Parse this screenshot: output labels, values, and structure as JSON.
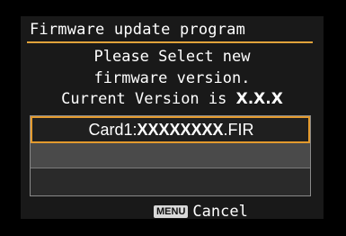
{
  "dialog": {
    "title": "Firmware update program",
    "message_line1": "Please Select new",
    "message_line2": "firmware version.",
    "version_prefix": "Current Version is ",
    "version_value": "X.X.X"
  },
  "file_list": {
    "selected_prefix": "Card1:",
    "selected_name": "XXXXXXXX",
    "selected_ext": ".FIR"
  },
  "footer": {
    "menu_key": "MENU",
    "cancel_label": "Cancel"
  },
  "colors": {
    "accent": "#e39a2e",
    "background": "#000000",
    "text": "#ffffff"
  }
}
